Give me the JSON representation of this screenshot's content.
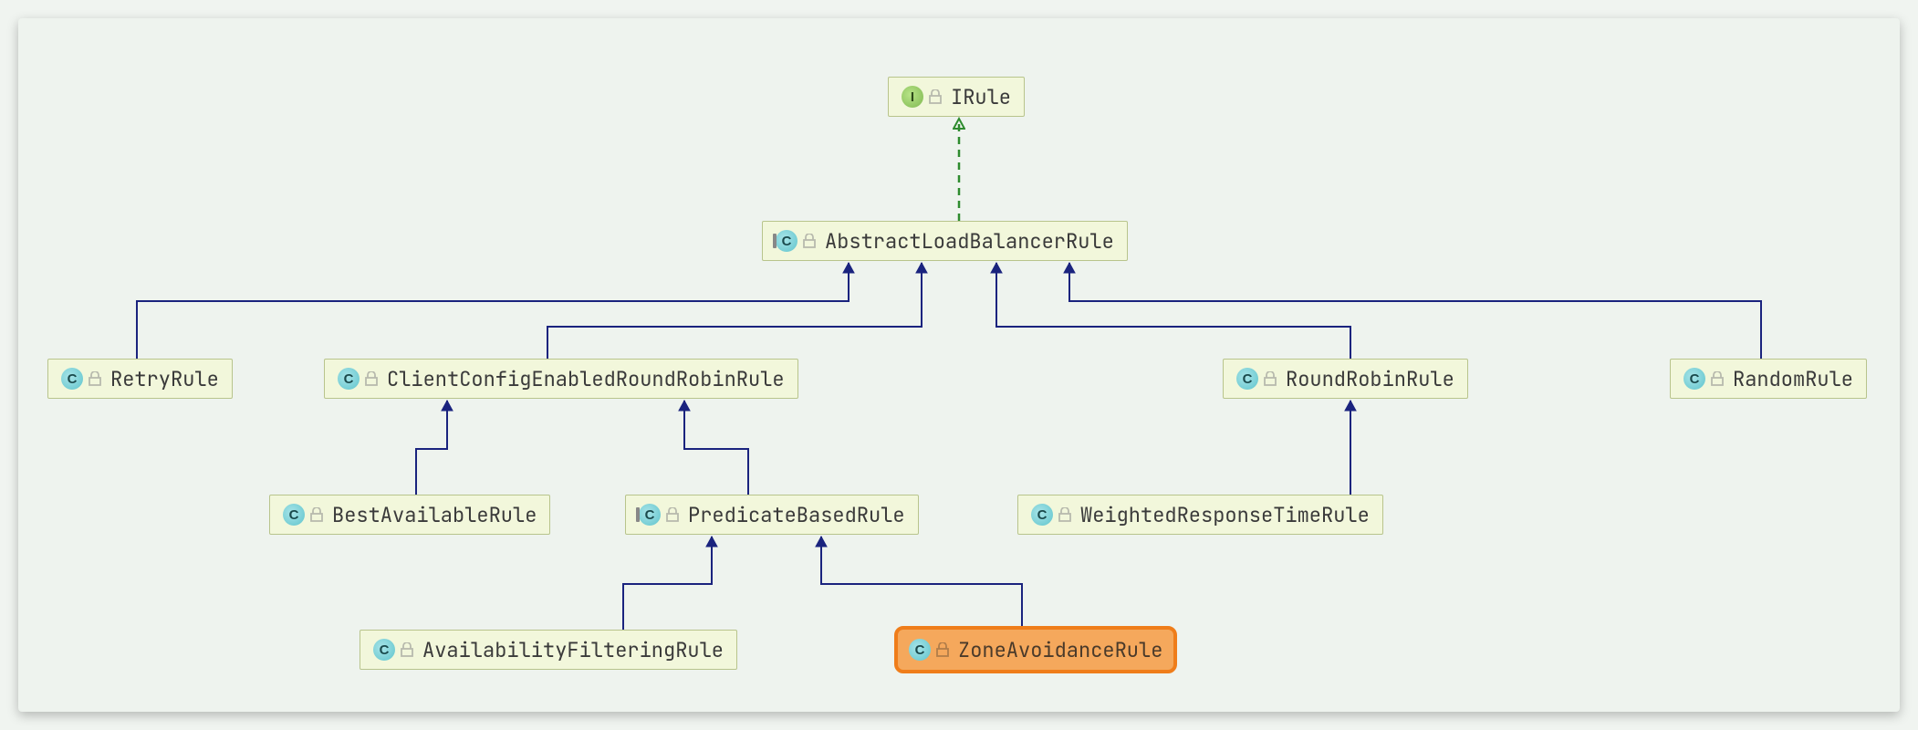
{
  "nodes": {
    "irule": {
      "label": "IRule",
      "kind": "interface",
      "kind_letter": "I",
      "highlighted": false
    },
    "abstract": {
      "label": "AbstractLoadBalancerRule",
      "kind": "abstract-class",
      "kind_letter": "C",
      "highlighted": false
    },
    "retry": {
      "label": "RetryRule",
      "kind": "class",
      "kind_letter": "C",
      "highlighted": false
    },
    "clientconfig": {
      "label": "ClientConfigEnabledRoundRobinRule",
      "kind": "class",
      "kind_letter": "C",
      "highlighted": false
    },
    "roundrobin": {
      "label": "RoundRobinRule",
      "kind": "class",
      "kind_letter": "C",
      "highlighted": false
    },
    "random": {
      "label": "RandomRule",
      "kind": "class",
      "kind_letter": "C",
      "highlighted": false
    },
    "bestavail": {
      "label": "BestAvailableRule",
      "kind": "class",
      "kind_letter": "C",
      "highlighted": false
    },
    "predicate": {
      "label": "PredicateBasedRule",
      "kind": "abstract-class",
      "kind_letter": "C",
      "highlighted": false
    },
    "weighted": {
      "label": "WeightedResponseTimeRule",
      "kind": "class",
      "kind_letter": "C",
      "highlighted": false
    },
    "availfilter": {
      "label": "AvailabilityFilteringRule",
      "kind": "class",
      "kind_letter": "C",
      "highlighted": false
    },
    "zoneavoid": {
      "label": "ZoneAvoidanceRule",
      "kind": "class",
      "kind_letter": "C",
      "highlighted": true
    }
  },
  "edges": [
    {
      "from": "abstract",
      "to": "irule",
      "style": "implements"
    },
    {
      "from": "retry",
      "to": "abstract",
      "style": "extends"
    },
    {
      "from": "clientconfig",
      "to": "abstract",
      "style": "extends"
    },
    {
      "from": "roundrobin",
      "to": "abstract",
      "style": "extends"
    },
    {
      "from": "random",
      "to": "abstract",
      "style": "extends"
    },
    {
      "from": "bestavail",
      "to": "clientconfig",
      "style": "extends"
    },
    {
      "from": "predicate",
      "to": "clientconfig",
      "style": "extends"
    },
    {
      "from": "weighted",
      "to": "roundrobin",
      "style": "extends"
    },
    {
      "from": "availfilter",
      "to": "predicate",
      "style": "extends"
    },
    {
      "from": "zoneavoid",
      "to": "predicate",
      "style": "extends"
    }
  ],
  "colors": {
    "implements_stroke": "#2e8b2e",
    "extends_stroke": "#1a237e",
    "highlight_bg": "#f5a85c",
    "highlight_border": "#ef7d1a",
    "node_bg": "#f2f7db",
    "node_border": "#b8c48c"
  }
}
